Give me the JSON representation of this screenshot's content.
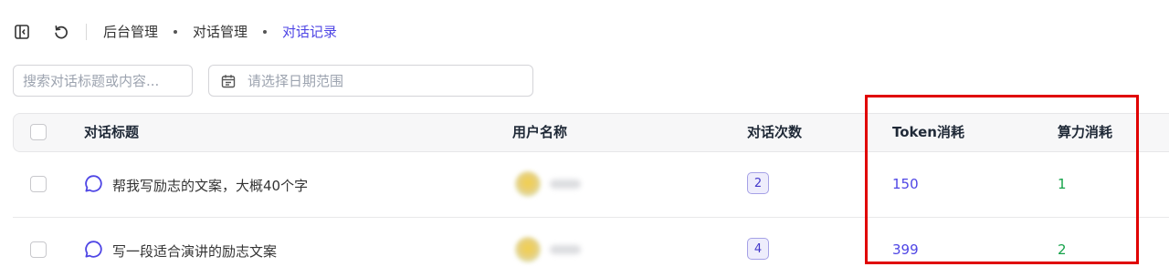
{
  "breadcrumb": {
    "items": [
      {
        "label": "后台管理"
      },
      {
        "label": "对话管理"
      },
      {
        "label": "对话记录"
      }
    ]
  },
  "filters": {
    "search_placeholder": "搜索对话标题或内容...",
    "date_placeholder": "请选择日期范围"
  },
  "table": {
    "columns": [
      "对话标题",
      "用户名称",
      "对话次数",
      "Token消耗",
      "算力消耗"
    ],
    "rows": [
      {
        "title": "帮我写励志的文案，大概40个字",
        "count": "2",
        "token": "150",
        "power": "1"
      },
      {
        "title": "写一段适合演讲的励志文案",
        "count": "4",
        "token": "399",
        "power": "2"
      }
    ]
  },
  "colors": {
    "accent": "#4f46e5",
    "power_green": "#16a34a",
    "highlight_red": "#e00000"
  }
}
